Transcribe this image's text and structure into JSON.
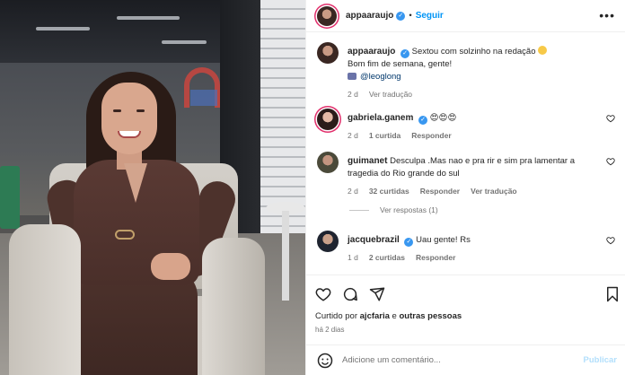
{
  "header": {
    "username": "appaaraujo",
    "separator": "•",
    "follow_label": "Seguir",
    "more": "•••"
  },
  "caption": {
    "username": "appaaraujo",
    "text": "Sextou com solzinho na redação",
    "line2": "Bom fim de semana, gente!",
    "mention": "@leoglong",
    "time": "2 d",
    "translate": "Ver tradução"
  },
  "comments": [
    {
      "username": "gabriela.ganem",
      "verified": true,
      "text": "😍😍😍",
      "time": "2 d",
      "likes": "1 curtida",
      "reply": "Responder"
    },
    {
      "username": "guimanet",
      "verified": false,
      "text": "Desculpa .Mas nao e pra rir e sim pra lamentar a tragedia do Rio grande do sul",
      "time": "2 d",
      "likes": "32 curtidas",
      "reply": "Responder",
      "translate": "Ver tradução",
      "view_replies": "Ver respostas (1)"
    },
    {
      "username": "jacquebrazil",
      "verified": true,
      "text": "Uau gente! Rs",
      "time": "1 d",
      "likes": "2 curtidas",
      "reply": "Responder"
    }
  ],
  "footer": {
    "liked_by_prefix": "Curtido por ",
    "liked_by_user": "ajcfaria",
    "liked_by_mid": " e ",
    "liked_by_others": "outras pessoas",
    "date": "há 2 dias",
    "comment_placeholder": "Adicione um comentário...",
    "publish": "Publicar"
  },
  "icons": [
    "heart-icon",
    "comment-icon",
    "share-icon",
    "bookmark-icon",
    "emoji-icon",
    "more-icon",
    "verified-icon"
  ],
  "colors": {
    "accent": "#0095f6",
    "verified": "#3897f0",
    "muted": "#737373",
    "text": "#262626"
  }
}
